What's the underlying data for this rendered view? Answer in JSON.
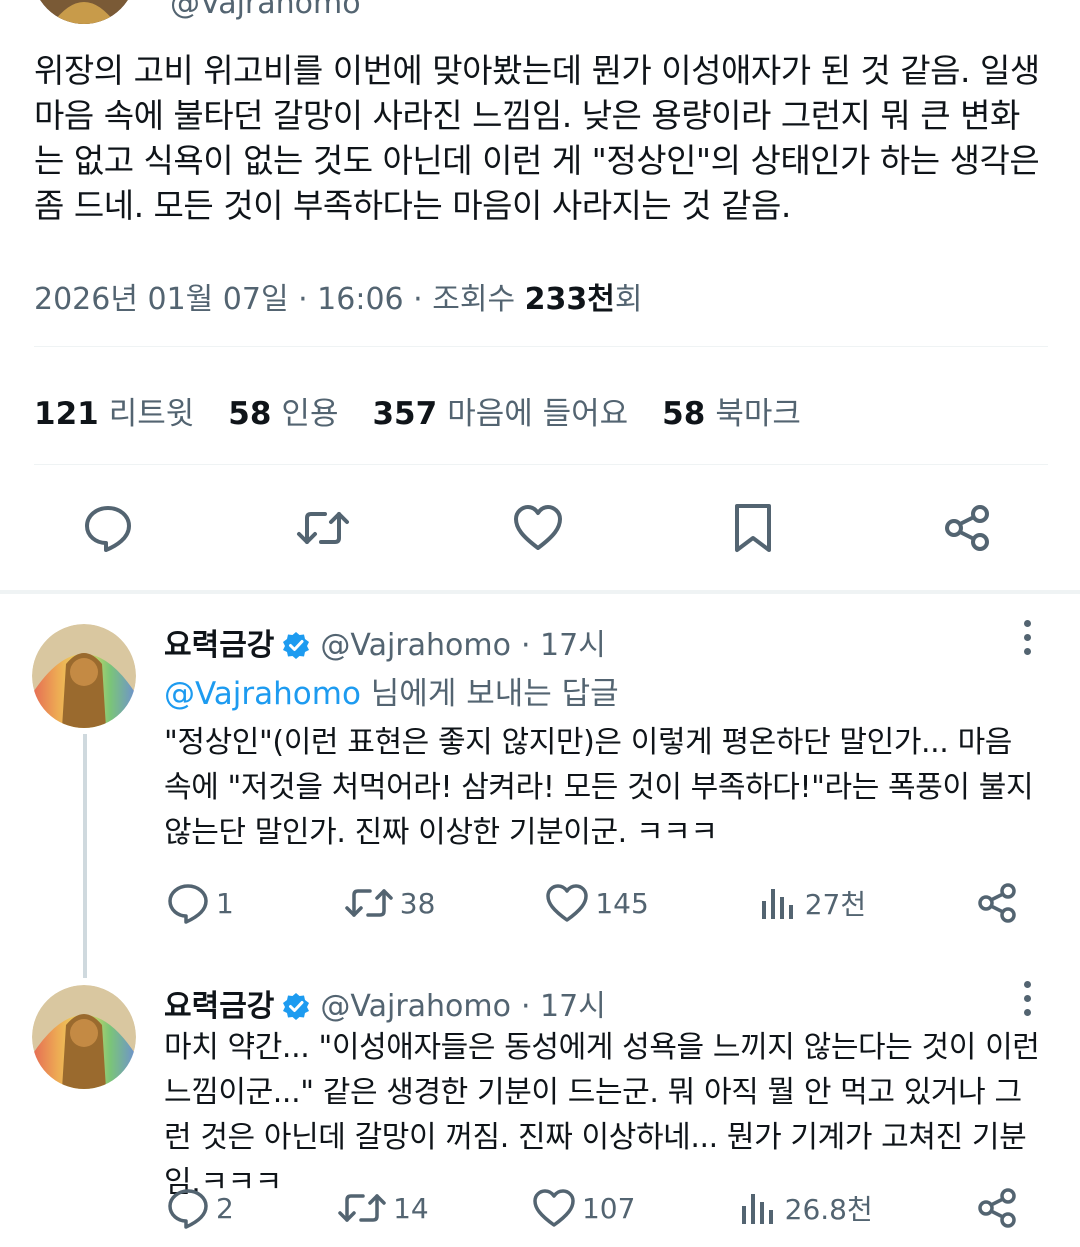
{
  "top_tweet": {
    "handle_partial": "@Vajrahomo",
    "text": "위장의 고비 위고비를 이번에 맞아봤는데 뭔가 이성애자가 된 것 같음. 일생 마음 속에 불타던 갈망이 사라진 느낌임. 낮은 용량이라 그런지 뭐 큰 변화는 없고 식욕이 없는 것도 아닌데 이런 게 \"정상인\"의 상태인가 하는 생각은 좀 드네. 모든 것이 부족하다는 마음이 사라지는 것 같음.",
    "meta_prefix": "2026년 01월 07일 · 16:06 · 조회수 ",
    "views_bold": "233천",
    "views_suffix": "회",
    "stats": [
      {
        "num": "121",
        "label": "리트윗"
      },
      {
        "num": "58",
        "label": "인용"
      },
      {
        "num": "357",
        "label": "마음에 들어요"
      },
      {
        "num": "58",
        "label": "북마크"
      }
    ],
    "action_icons": [
      "reply-icon",
      "retweet-icon",
      "like-icon",
      "bookmark-icon",
      "share-icon"
    ]
  },
  "replies": [
    {
      "name": "요력금강",
      "handle": "@Vajrahomo",
      "time": "· 17시",
      "replying_to": "@Vajrahomo",
      "replying_suffix": " 님에게 보내는 답글",
      "text": "\"정상인\"(이런 표현은 좋지 않지만)은 이렇게 평온하단 말인가... 마음 속에 \"저것을 처먹어라! 삼켜라! 모든 것이 부족하다!\"라는 폭풍이 불지 않는단 말인가. 진짜 이상한 기분이군. ㅋㅋㅋ",
      "replies_count": "1",
      "retweets": "38",
      "likes": "145",
      "views": "27천"
    },
    {
      "name": "요력금강",
      "handle": "@Vajrahomo",
      "time": "· 17시",
      "text": "마치 약간... \"이성애자들은 동성에게 성욕을 느끼지 않는다는 것이 이런 느낌이군...\" 같은 생경한 기분이 드는군. 뭐 아직 뭘 안 먹고 있거나 그런 것은 아닌데 갈망이 꺼짐. 진짜 이상하네... 뭔가 기계가 고쳐진 기분임.ㅋㅋㅋ",
      "replies_count": "2",
      "retweets": "14",
      "likes": "107",
      "views": "26.8천"
    }
  ],
  "colors": {
    "text": "#0f1419",
    "muted": "#536471",
    "accent": "#1d9bf0",
    "divider": "#eff3f4"
  }
}
